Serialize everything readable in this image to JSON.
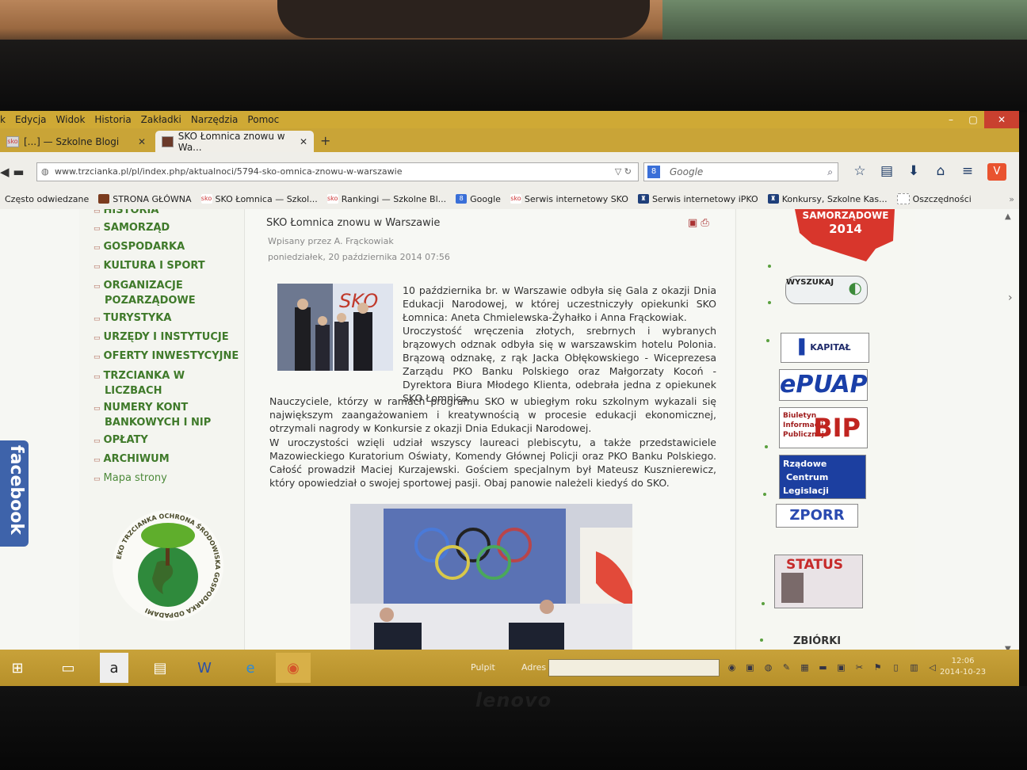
{
  "window": {
    "menu": [
      "Edycja",
      "Widok",
      "Historia",
      "Zakładki",
      "Narzędzia",
      "Pomoc"
    ],
    "controls": [
      "–",
      "▢",
      "✕"
    ]
  },
  "tabs": [
    {
      "label": "[...] — Szkolne Blogi",
      "close": "✕"
    },
    {
      "label": "SKO Łomnica znowu w Wa...",
      "close": "✕"
    }
  ],
  "new_tab": "+",
  "nav": {
    "url": "www.trzcianka.pl/pl/index.php/aktualnoci/5794-sko-omnica-znowu-w-warszawie",
    "search_placeholder": "Google"
  },
  "bookmarks": [
    "Często odwiedzane",
    "STRONA GŁÓWNA",
    "SKO Łomnica — Szkol...",
    "Rankingi — Szkolne Bl...",
    "Google",
    "Serwis internetowy SKO",
    "Serwis internetowy iPKO",
    "Konkursy, Szkolne Kas...",
    "Oszczędności"
  ],
  "sidebar_menu": [
    {
      "label": "HISTORIA"
    },
    {
      "label": "SAMORZĄD"
    },
    {
      "label": "GOSPODARKA"
    },
    {
      "label": "KULTURA I SPORT"
    },
    {
      "label": "ORGANIZACJE",
      "label2": "POZARZĄDOWE"
    },
    {
      "label": "TURYSTYKA"
    },
    {
      "label": "URZĘDY I INSTYTUCJE"
    },
    {
      "label": "OFERTY INWESTYCYJNE"
    },
    {
      "label": "TRZCIANKA W",
      "label2": "LICZBACH"
    },
    {
      "label": "NUMERY KONT",
      "label2": "BANKOWYCH I NIP"
    },
    {
      "label": "OPŁATY"
    },
    {
      "label": "ARCHIWUM"
    },
    {
      "label": "Mapa strony"
    }
  ],
  "facebook_label": "facebook",
  "eko": {
    "ring_text": "EKO TRZCIANKA OCHRONA ŚRODOWISKA GOSPODARKA ODPADAMI"
  },
  "article": {
    "title": "SKO Łomnica znowu w Warszawie",
    "author": "Wpisany przez A. Frąckowiak",
    "date": "poniedziałek, 20 października 2014 07:56",
    "photo_caption": "SKO",
    "p1": "10 października br. w Warszawie odbyła się Gala z okazji Dnia Edukacji Narodowej, w której uczestniczyły opiekunki SKO Łomnica: Aneta Chmielewska-Żyhałko i Anna Frąckowiak.",
    "p2": "Uroczystość wręczenia złotych, srebrnych i wybranych brązowych odznak odbyła się w warszawskim hotelu Polonia. Brązową odznakę, z rąk Jacka Obłękowskiego - Wiceprezesa Zarządu PKO Banku Polskiego oraz Małgorzaty Kocoń - Dyrektora Biura Młodego Klienta, odebrała jedna z opiekunek SKO Łomnica.",
    "p3": "Nauczyciele, którzy w ramach programu SKO w ubiegłym roku szkolnym wykazali się największym zaangażowaniem i kreatywnością w procesie edukacji ekonomicznej, otrzymali nagrody w Konkursie z okazji Dnia Edukacji Narodowej.",
    "p4": "W uroczystości wzięli udział wszyscy laureaci plebiscytu, a także przedstawiciele Mazowieckiego Kuratorium Oświaty, Komendy Głównej Policji oraz PKO Banku Polskiego. Całość prowadził Maciej Kurzajewski. Gościem specjalnym był Mateusz Kusznierewicz, który opowiedział o swojej sportowej pasji. Obaj panowie należeli kiedyś do SKO."
  },
  "right_banners": {
    "samorzadowe": "SAMORZĄDOWE",
    "year": "2014",
    "search": "WYSZUKAJ",
    "kapital": "KAPITAŁ LUDZKI",
    "epuap": "ePUAP",
    "bip_lines": [
      "Biuletyn",
      "Informacji",
      "Publicznej"
    ],
    "bip": "BIP",
    "rcl_lines": [
      "Rządowe",
      "Centrum",
      "Legislacji"
    ],
    "zporr": "ZPORR",
    "status": "STATUS",
    "zbiorki": "ZBIÓRKI"
  },
  "taskbar": {
    "pulpit": "Pulpit",
    "adres": "Adres",
    "time": "12:06",
    "date": "2014-10-23"
  },
  "device_brand": "lenovo",
  "colors": {
    "chrome": "#cfa935",
    "menu_green": "#3f7a2a",
    "facebook": "#3e63aa"
  }
}
